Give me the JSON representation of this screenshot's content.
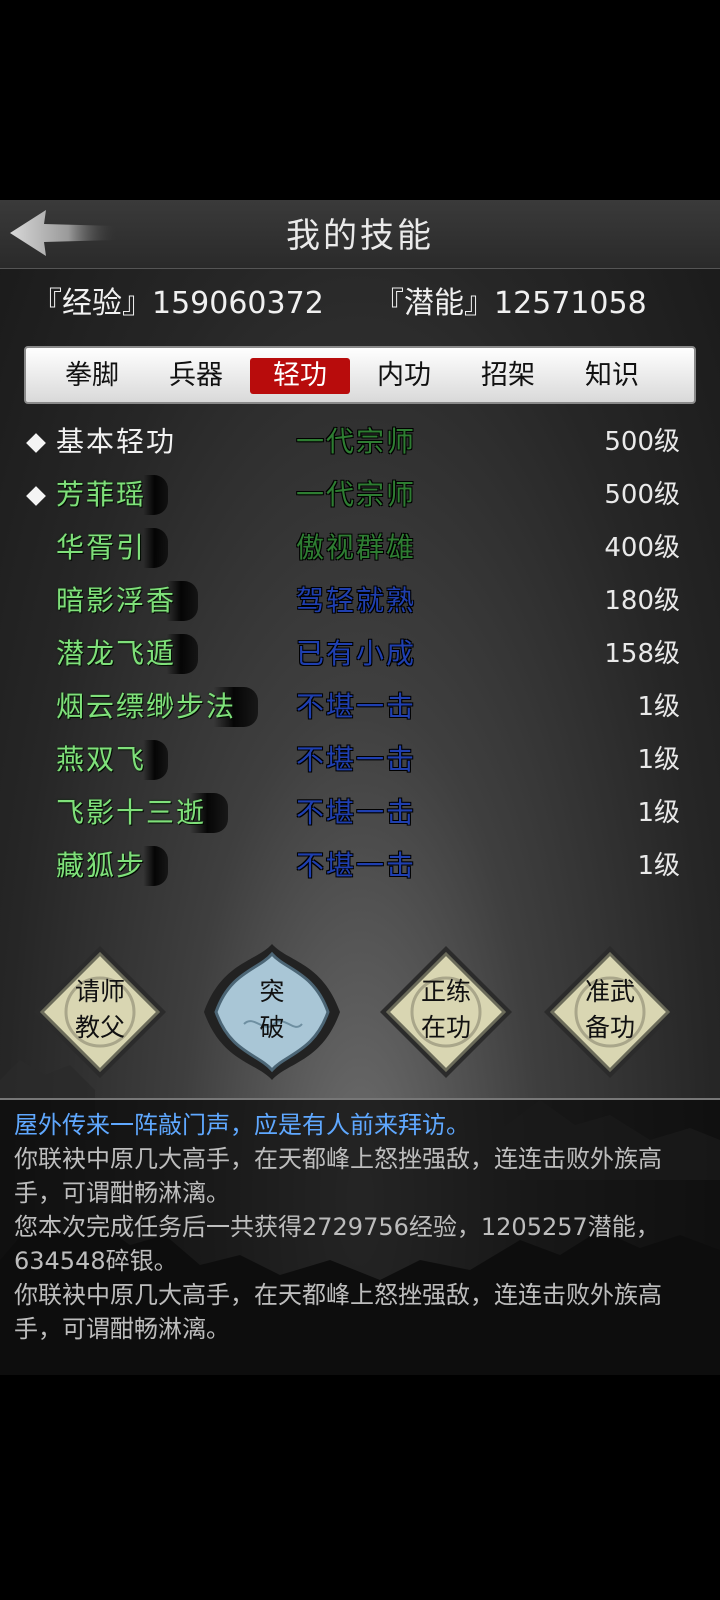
{
  "header": {
    "title": "我的技能"
  },
  "stats": {
    "exp_label": "『经验』",
    "exp_value": "159060372",
    "potential_label": "『潜能』",
    "potential_value": "12571058"
  },
  "tabs": [
    {
      "label": "拳脚",
      "active": false
    },
    {
      "label": "兵器",
      "active": false
    },
    {
      "label": "轻功",
      "active": true
    },
    {
      "label": "内功",
      "active": false
    },
    {
      "label": "招架",
      "active": false
    },
    {
      "label": "知识",
      "active": false
    }
  ],
  "skills": [
    {
      "name": "基本轻功",
      "rank": "一代宗师",
      "level": "500级",
      "marked": true
    },
    {
      "name": "芳菲瑶",
      "rank": "一代宗师",
      "level": "500级",
      "marked": true
    },
    {
      "name": "华胥引",
      "rank": "傲视群雄",
      "level": "400级",
      "marked": false
    },
    {
      "name": "暗影浮香",
      "rank": "驾轻就熟",
      "level": "180级",
      "marked": false
    },
    {
      "name": "潜龙飞遁",
      "rank": "已有小成",
      "level": "158级",
      "marked": false
    },
    {
      "name": "烟云缥缈步法",
      "rank": "不堪一击",
      "level": "1级",
      "marked": false
    },
    {
      "name": "燕双飞",
      "rank": "不堪一击",
      "level": "1级",
      "marked": false
    },
    {
      "name": "飞影十三逝",
      "rank": "不堪一击",
      "level": "1级",
      "marked": false
    },
    {
      "name": "藏狐步",
      "rank": "不堪一击",
      "level": "1级",
      "marked": false
    }
  ],
  "actions": [
    {
      "line1": "请师",
      "line2": "教父"
    },
    {
      "line1": "突",
      "line2": "破"
    },
    {
      "line1": "正练",
      "line2": "在功"
    },
    {
      "line1": "准武",
      "line2": "备功"
    }
  ],
  "log": [
    "屋外传来一阵敲门声，应是有人前来拜访。",
    "你联袂中原几大高手，在天都峰上怒挫强敌，连连击败外族高手，可谓酣畅淋漓。",
    "您本次完成任务后一共获得2729756经验，1205257潜能，634548碎银。",
    "你联袂中原几大高手，在天都峰上怒挫强敌，连连击败外族高手，可谓酣畅淋漓。"
  ],
  "colors": {
    "tab_active": "#b80c0c",
    "rank_green": "#2e7d32",
    "rank_blue": "#1f3fb0",
    "log_highlight": "#5fa8ff"
  }
}
